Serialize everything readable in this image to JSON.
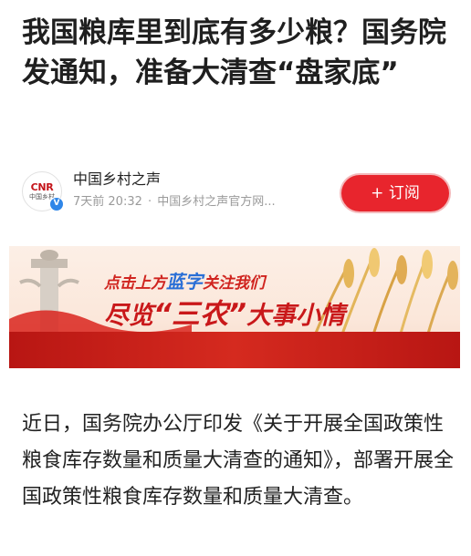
{
  "article": {
    "title": "我国粮库里到底有多少粮？国务院发通知，准备大清查“盘家底”"
  },
  "author": {
    "name": "中国乡村之声",
    "avatar_logo": "CNR",
    "avatar_sub": "中国乡村",
    "verified_mark": "V",
    "time": "7天前 20:32",
    "separator": "·",
    "source": "中国乡村之声官方网..."
  },
  "subscribe": {
    "label": "+ 订阅",
    "color": "#e8252d"
  },
  "banner": {
    "line1_a": "点击上方",
    "line1_b": "蓝字",
    "line1_c": "关注我们",
    "line2_a": "尽览",
    "line2_b": "“三农”",
    "line2_c": "大事小情"
  },
  "body": {
    "paragraph": "近日，国务院办公厅印发《关于开展全国政策性粮食库存数量和质量大清查的通知》，部署开展全国政策性粮食库存数量和质量大清查。"
  }
}
